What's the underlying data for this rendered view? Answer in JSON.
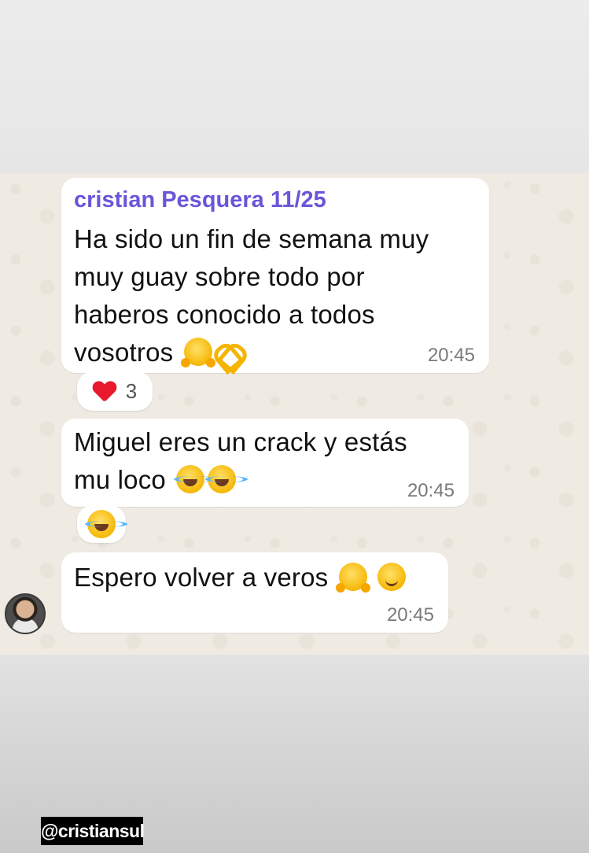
{
  "messages": [
    {
      "sender": "cristian Pesquera 11/25",
      "text_lines": [
        "Ha sido un fin de semana muy",
        "muy guay sobre todo por",
        "haberos conocido a todos",
        "vosotros"
      ],
      "emojis": [
        "hugging-face",
        "heart-hands"
      ],
      "time": "20:45",
      "reaction": {
        "emoji": "red-heart",
        "count": "3"
      }
    },
    {
      "text_lines": [
        "Miguel eres un crack y estás",
        "mu loco"
      ],
      "emojis": [
        "tears-of-joy",
        "tears-of-joy"
      ],
      "time": "20:45",
      "reaction": {
        "emoji": "tears-of-joy"
      }
    },
    {
      "text_lines": [
        "Espero volver a veros"
      ],
      "emojis": [
        "hugging-face",
        "slightly-smiling-face"
      ],
      "time": "20:45"
    }
  ],
  "watermark": "@cristiansul",
  "colors": {
    "sender_name": "#6a55d8",
    "chat_background": "#efeae2",
    "bubble": "#ffffff"
  }
}
